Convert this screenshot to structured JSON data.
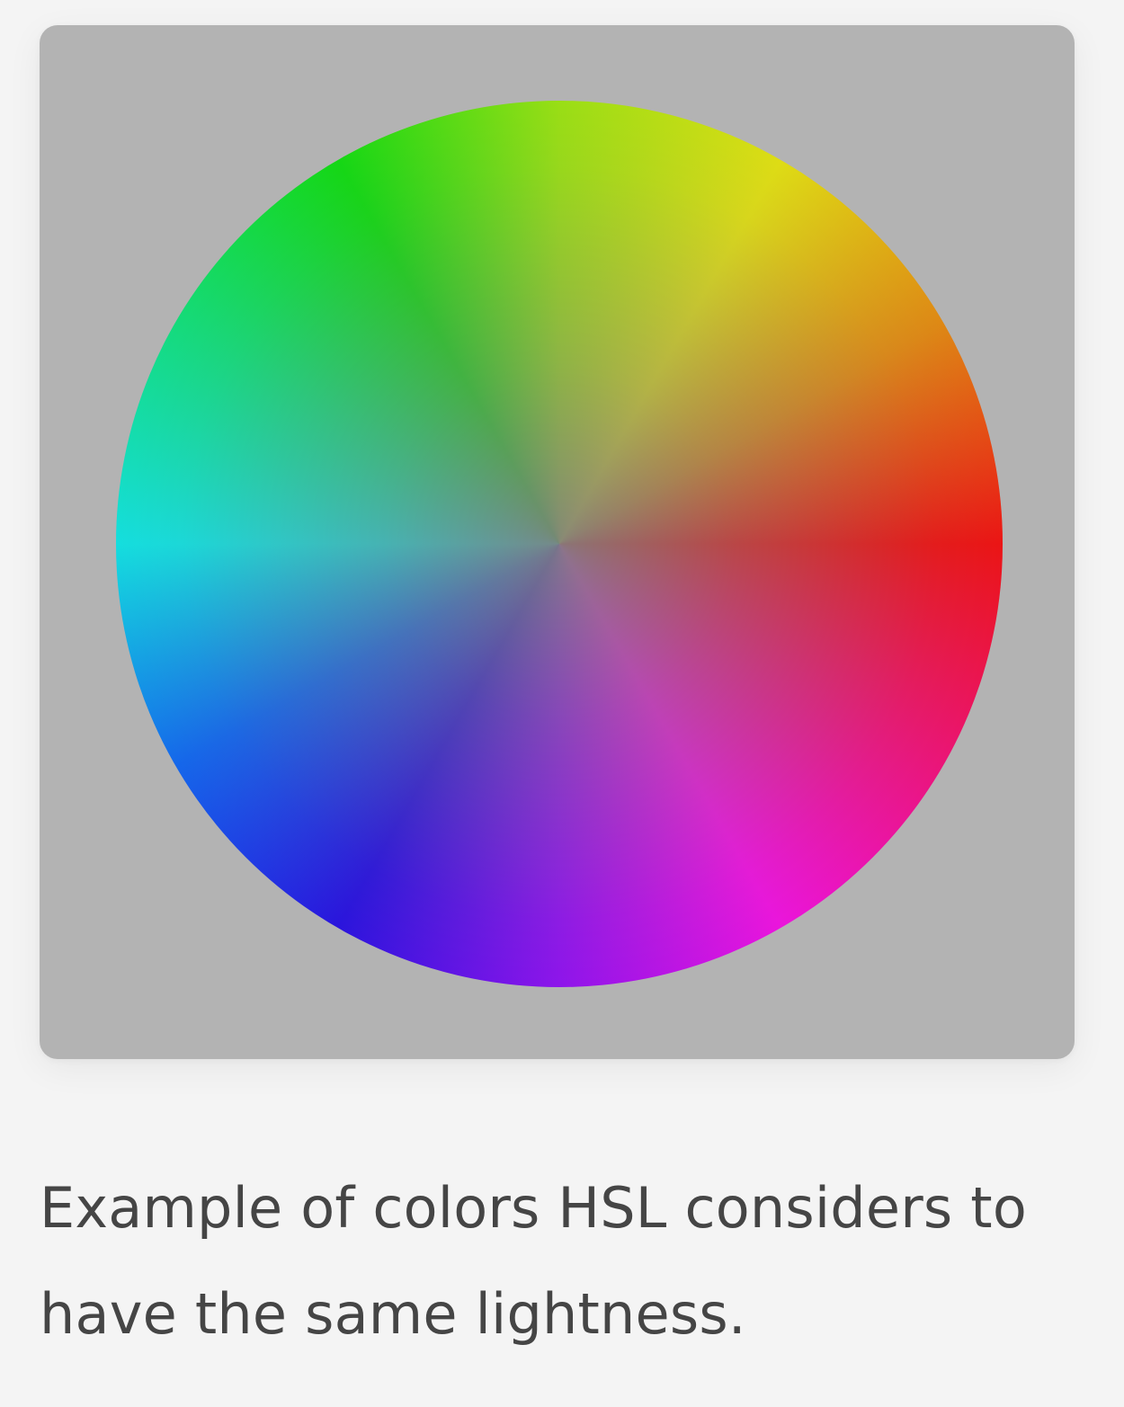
{
  "figure": {
    "background_color": "#b3b3b3",
    "image_description_name": "hsl-color-wheel"
  },
  "caption": {
    "text": "Example of colors HSL considers to have the same lightness."
  }
}
